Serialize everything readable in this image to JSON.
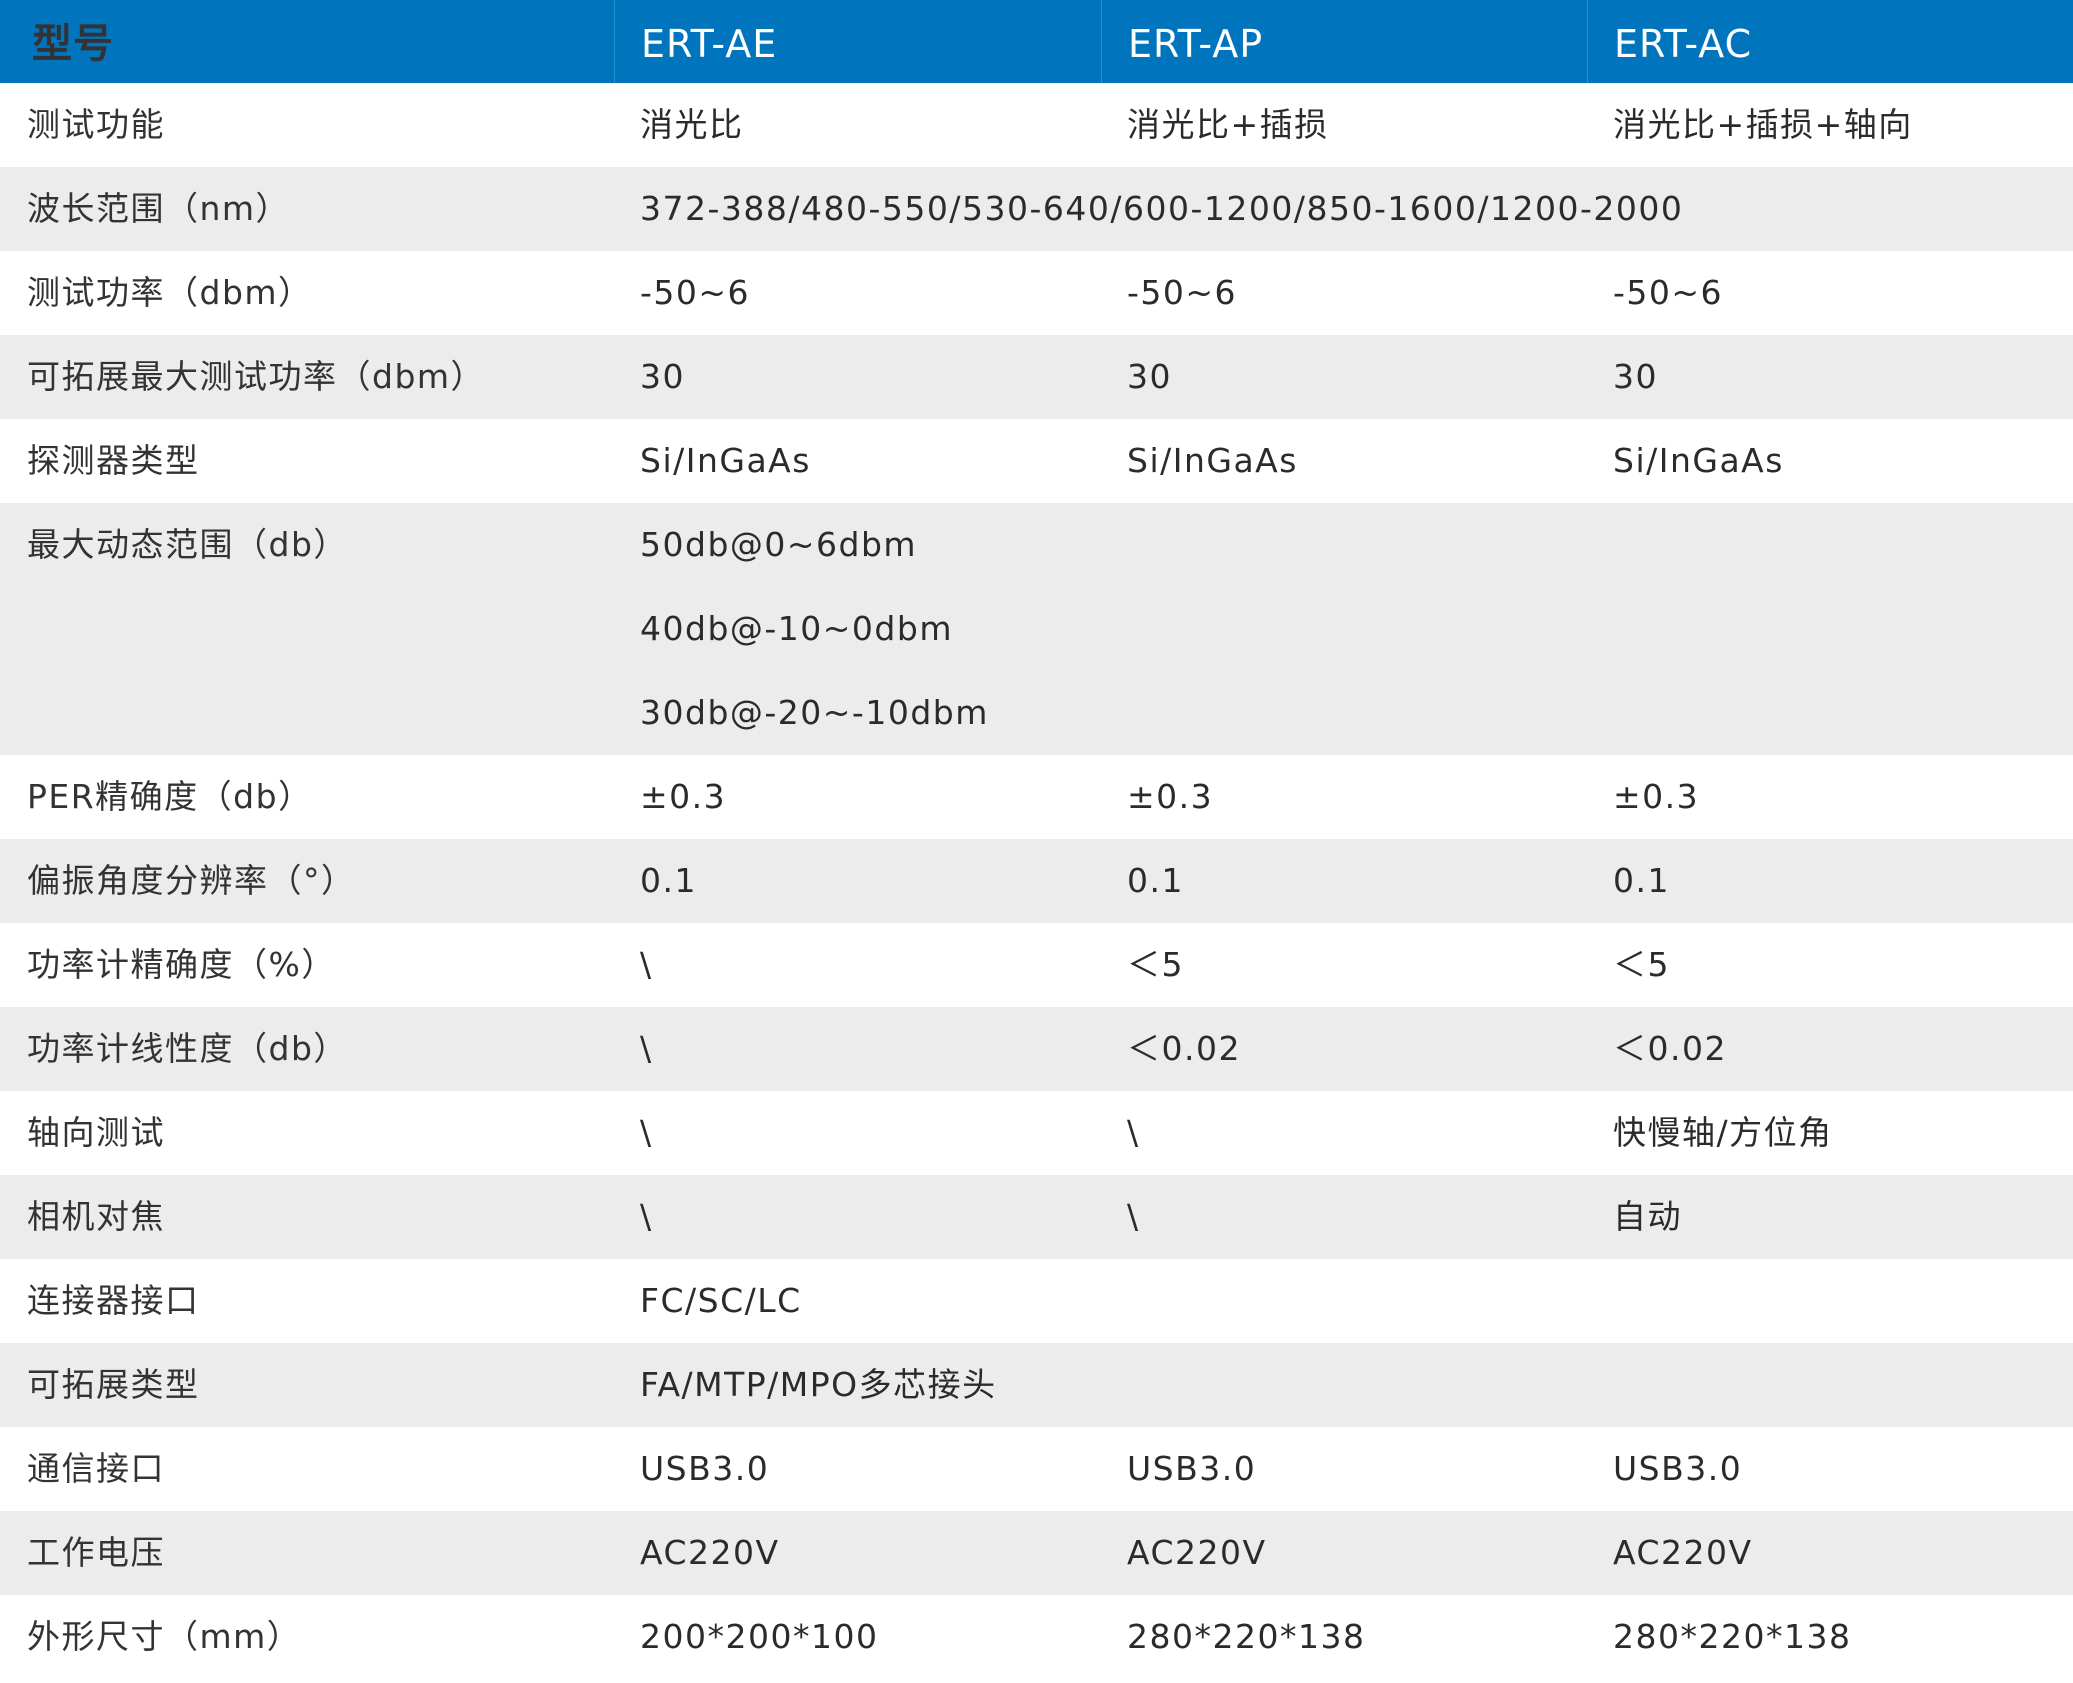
{
  "header": {
    "label": "型号",
    "models": [
      "ERT-AE",
      "ERT-AP",
      "ERT-AC"
    ]
  },
  "rows": {
    "test_function": {
      "label": "测试功能",
      "values": [
        "消光比",
        "消光比+插损",
        "消光比+插损+轴向"
      ]
    },
    "wavelength": {
      "label": "波长范围（nm）",
      "value": "372-388/480-550/530-640/600-1200/850-1600/1200-2000"
    },
    "test_power": {
      "label": "测试功率（dbm）",
      "values": [
        "-50~6",
        "-50~6",
        "-50~6"
      ]
    },
    "max_power": {
      "label": "可拓展最大测试功率（dbm）",
      "values": [
        "30",
        "30",
        "30"
      ]
    },
    "detector": {
      "label": "探测器类型",
      "values": [
        "Si/InGaAs",
        "Si/InGaAs",
        "Si/InGaAs"
      ]
    },
    "dynamic_range": {
      "label": "最大动态范围（db）",
      "lines": [
        "50db@0~6dbm",
        "40db@-10~0dbm",
        "30db@-20~-10dbm"
      ]
    },
    "per_accuracy": {
      "label": "PER精确度（db）",
      "values": [
        "±0.3",
        "±0.3",
        "±0.3"
      ]
    },
    "angle_resolution": {
      "label": "偏振角度分辨率（°）",
      "values": [
        "0.1",
        "0.1",
        "0.1"
      ]
    },
    "meter_accuracy": {
      "label": "功率计精确度（%）",
      "values": [
        "\\",
        "＜5",
        "＜5"
      ]
    },
    "meter_linearity": {
      "label": "功率计线性度（db）",
      "values": [
        "\\",
        "＜0.02",
        "＜0.02"
      ]
    },
    "axial_test": {
      "label": "轴向测试",
      "values": [
        "\\",
        "\\",
        "快慢轴/方位角"
      ]
    },
    "camera_focus": {
      "label": "相机对焦",
      "values": [
        "\\",
        "\\",
        "自动"
      ]
    },
    "connector": {
      "label": "连接器接口",
      "value": "FC/SC/LC"
    },
    "ext_type": {
      "label": "可拓展类型",
      "value": "FA/MTP/MPO多芯接头"
    },
    "comm": {
      "label": "通信接口",
      "values": [
        "USB3.0",
        "USB3.0",
        "USB3.0"
      ]
    },
    "voltage": {
      "label": "工作电压",
      "values": [
        "AC220V",
        "AC220V",
        "AC220V"
      ]
    },
    "dimensions": {
      "label": "外形尺寸（mm）",
      "values": [
        "200*200*100",
        "280*220*138",
        "280*220*138"
      ]
    }
  },
  "colors": {
    "header_bg": "#0074bd",
    "stripe_bg": "#ececec",
    "text": "#2b2b2b"
  }
}
